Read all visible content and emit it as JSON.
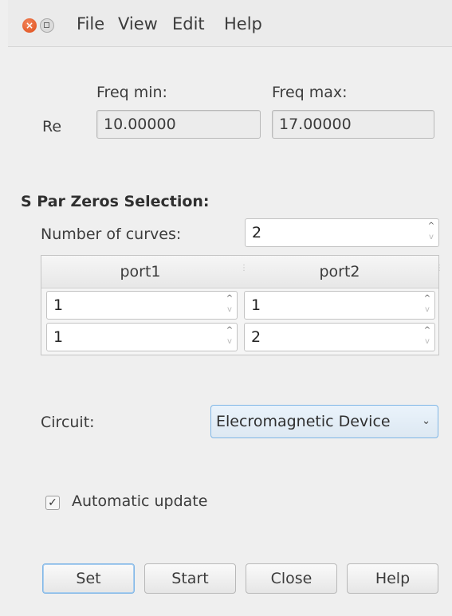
{
  "menubar": {
    "close_glyph": "×",
    "items": [
      "File",
      "View",
      "Edit",
      "Help"
    ]
  },
  "freq": {
    "row_label": "Re",
    "min_label": "Freq min:",
    "max_label": "Freq max:",
    "min_value": "10.00000",
    "max_value": "17.00000"
  },
  "zeros": {
    "title": "S Par Zeros Selection:",
    "curves_label": "Number of curves:",
    "curves_value": "2",
    "columns": [
      "port1",
      "port2"
    ],
    "rows": [
      [
        "1",
        "1"
      ],
      [
        "1",
        "2"
      ]
    ]
  },
  "circuit": {
    "label": "Circuit:",
    "selected": "Elecromagnetic Device"
  },
  "auto_update": {
    "label": "Automatic update",
    "checked": true,
    "check_glyph": "✓"
  },
  "buttons": {
    "set": "Set",
    "start": "Start",
    "close": "Close",
    "help": "Help"
  },
  "colors": {
    "close_button": "#df4b16",
    "focus_accent": "#7fb6e6",
    "background": "#efefef"
  }
}
